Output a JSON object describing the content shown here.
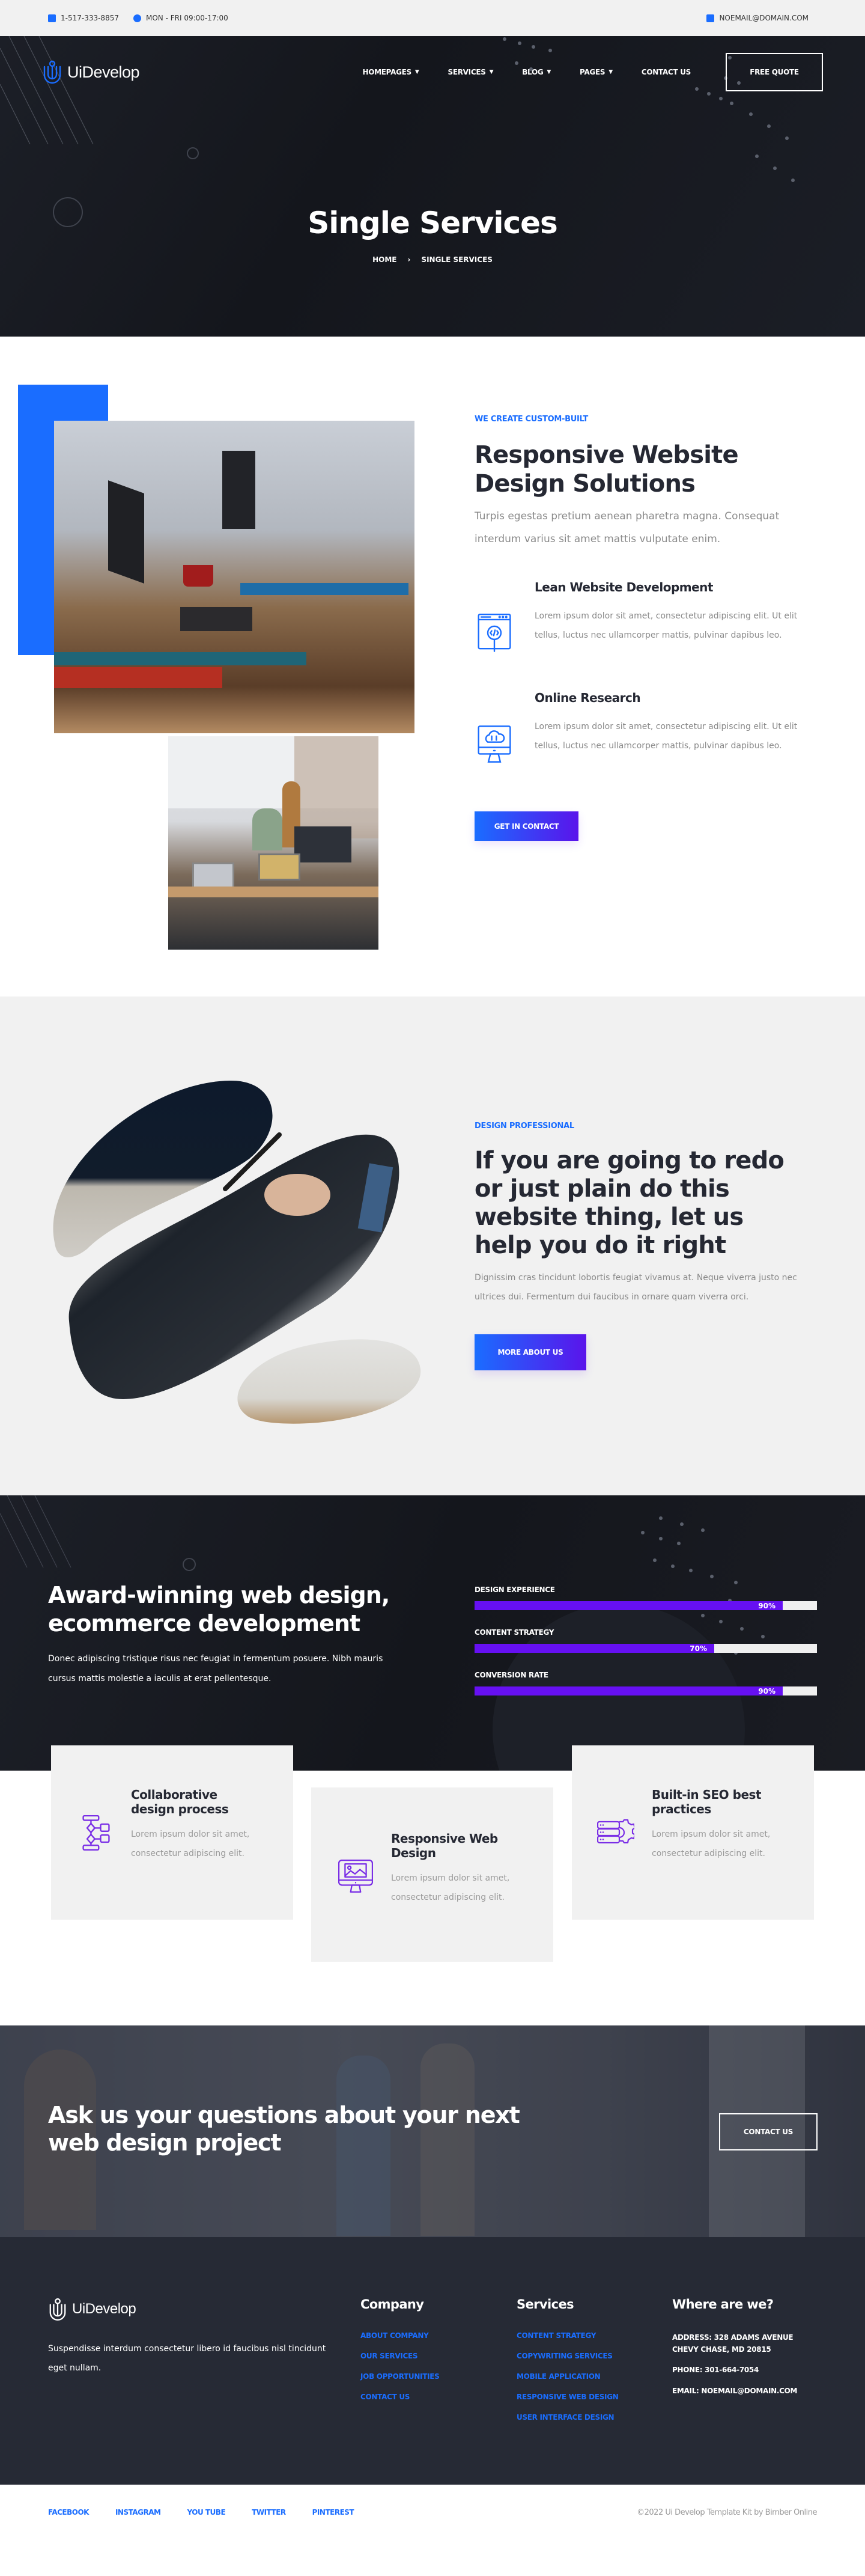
{
  "topbar": {
    "phone": "1-517-333-8857",
    "hours": "MON - FRI 09:00-17:00",
    "email": "NOEMAIL@DOMAIN.COM",
    "icons": {
      "phone": "phone-icon",
      "hours": "clock-icon",
      "email": "envelope-icon"
    }
  },
  "nav": {
    "logo_text": "UiDevelop",
    "items": [
      {
        "label": "HOMEPAGES",
        "has_dropdown": true
      },
      {
        "label": "SERVICES",
        "has_dropdown": true
      },
      {
        "label": "BLOG",
        "has_dropdown": true
      },
      {
        "label": "PAGES",
        "has_dropdown": true
      },
      {
        "label": "CONTACT US",
        "has_dropdown": false
      }
    ],
    "cta_label": "FREE QUOTE"
  },
  "hero": {
    "title": "Single Services",
    "breadcrumb": [
      "HOME",
      "SINGLE SERVICES"
    ]
  },
  "section_solutions": {
    "eyebrow": "WE CREATE CUSTOM-BUILT",
    "title": "Responsive Website Design Solutions",
    "lead": "Turpis egestas pretium aenean pharetra magna. Consequat interdum varius sit amet mattis vulputate enim.",
    "features": [
      {
        "icon": "code-search-window-icon",
        "title": "Lean Website Development",
        "text": "Lorem ipsum dolor sit amet, consectetur adipiscing elit. Ut elit tellus, luctus nec ullamcorper mattis, pulvinar dapibus leo."
      },
      {
        "icon": "cloud-monitor-icon",
        "title": "Online Research",
        "text": "Lorem ipsum dolor sit amet, consectetur adipiscing elit. Ut elit tellus, luctus nec ullamcorper mattis, pulvinar dapibus leo."
      }
    ],
    "button_label": "GET IN CONTACT"
  },
  "section_professional": {
    "eyebrow": "DESIGN PROFESSIONAL",
    "title": "If you are going to redo or just plain do this website thing, let us help you do it right",
    "text": "Dignissim cras tincidunt lobortis feugiat vivamus at. Neque viverra justo nec ultrices dui. Fermentum dui faucibus in ornare quam viverra orci.",
    "button_label": "MORE ABOUT US"
  },
  "section_award": {
    "title": "Award-winning web design, ecommerce development",
    "text": "Donec adipiscing tristique risus nec feugiat in fermentum posuere. Nibh mauris cursus mattis molestie a iaculis at erat pellentesque.",
    "skills": [
      {
        "label": "DESIGN EXPERIENCE",
        "percent": 90,
        "display": "90%"
      },
      {
        "label": "CONTENT STRATEGY",
        "percent": 70,
        "display": "70%"
      },
      {
        "label": "CONVERSION RATE",
        "percent": 90,
        "display": "90%"
      }
    ],
    "colors": {
      "bar_fill": "#6610f2",
      "bar_track": "#efefef"
    }
  },
  "cards": [
    {
      "icon": "flowchart-icon",
      "title": "Collaborative design process",
      "text": "Lorem ipsum dolor sit amet, consectetur adipiscing elit."
    },
    {
      "icon": "monitor-image-icon",
      "title": "Responsive Web Design",
      "text": "Lorem ipsum dolor sit amet, consectetur adipiscing elit."
    },
    {
      "icon": "server-gear-icon",
      "title": "Built-in SEO best practices",
      "text": "Lorem ipsum dolor sit amet, consectetur adipiscing elit."
    }
  ],
  "cta": {
    "title": "Ask us your questions about your next web design project",
    "button_label": "CONTACT US"
  },
  "footer": {
    "logo_text": "UiDevelop",
    "about": "Suspendisse interdum consectetur libero id faucibus nisl tincidunt eget nullam.",
    "company": {
      "heading": "Company",
      "links": [
        "ABOUT COMPANY",
        "OUR SERVICES",
        "JOB OPPORTUNITIES",
        "CONTACT US"
      ]
    },
    "services": {
      "heading": "Services",
      "links": [
        "CONTENT STRATEGY",
        "COPYWRITING SERVICES",
        "MOBILE APPLICATION",
        "RESPONSIVE WEB DESIGN",
        "USER INTERFACE DESIGN"
      ]
    },
    "contact": {
      "heading": "Where are we?",
      "address_line1": "ADDRESS: 328 ADAMS AVENUE",
      "address_line2": "CHEVY CHASE, MD 20815",
      "phone": "PHONE: 301-664-7054",
      "email": "EMAIL: NOEMAIL@DOMAIN.COM"
    }
  },
  "bottom_bar": {
    "social": [
      "FACEBOOK",
      "INSTAGRAM",
      "YOU TUBE",
      "TWITTER",
      "PINTEREST"
    ],
    "copyright": "©2022 Ui Develop Template Kit by Bimber Online"
  },
  "theme": {
    "accent_blue": "#1a6dff",
    "accent_purple": "#5a14eb",
    "dark": "#1c1f27",
    "footer_bg": "#262a35",
    "light_bg": "#f1f1f1"
  }
}
